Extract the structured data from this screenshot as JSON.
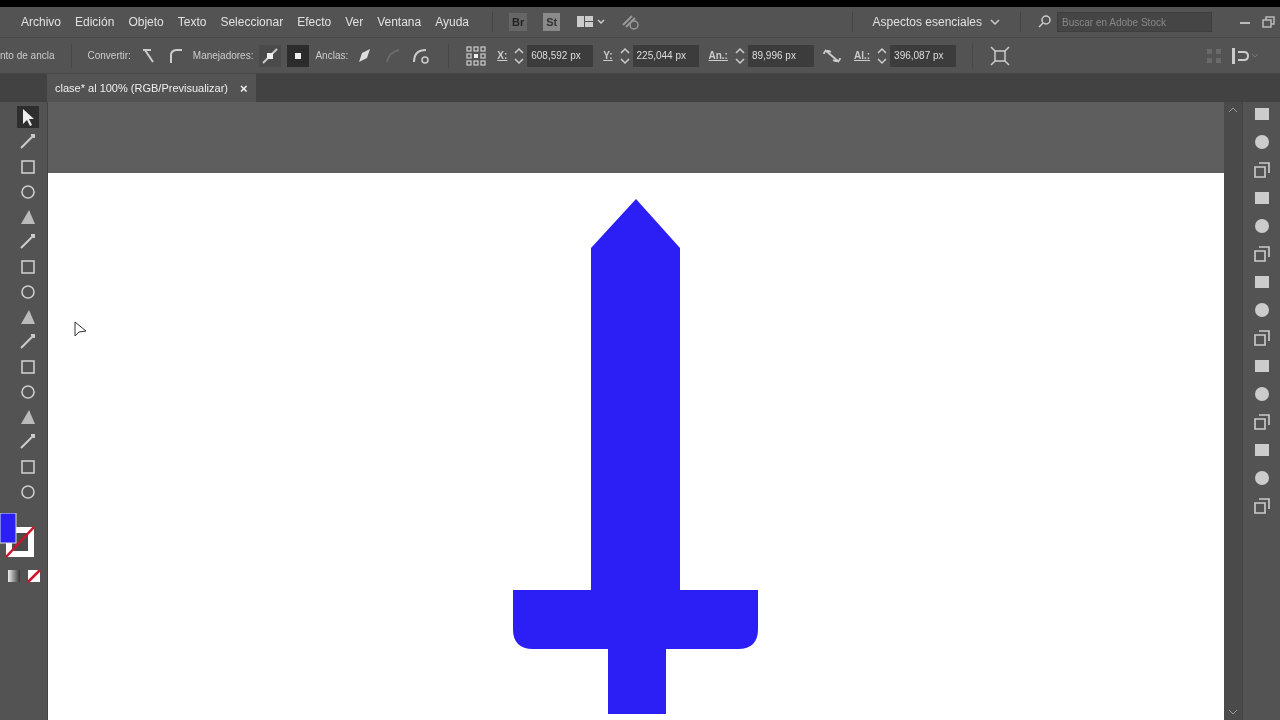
{
  "menu": [
    "Archivo",
    "Edición",
    "Objeto",
    "Texto",
    "Seleccionar",
    "Efecto",
    "Ver",
    "Ventana",
    "Ayuda"
  ],
  "app_icons": [
    "Br",
    "St"
  ],
  "workspace": "Aspectos esenciales",
  "search": {
    "placeholder": "Buscar en Adobe Stock"
  },
  "control_bar": {
    "tool_label": "nto de ancla",
    "convert_label": "Convertir:",
    "handles_label": "Manejadores:",
    "anchors_label": "Anclas:",
    "fields": [
      {
        "label": "X:",
        "value": "608,592 px"
      },
      {
        "label": "Y:",
        "value": "225,044 px"
      },
      {
        "label": "An.:",
        "value": "89,996 px"
      },
      {
        "label": "Al.:",
        "value": "396,087 px"
      }
    ]
  },
  "document_tab": {
    "title": "clase* al 100% (RGB/Previsualizar)",
    "close": "×"
  }
}
